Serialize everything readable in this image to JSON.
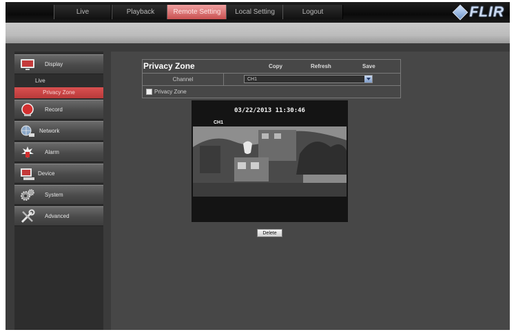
{
  "nav": {
    "tabs": [
      {
        "label": "Live",
        "active": false
      },
      {
        "label": "Playback",
        "active": false
      },
      {
        "label": "Remote Setting",
        "active": true
      },
      {
        "label": "Local Setting",
        "active": false
      },
      {
        "label": "Logout",
        "active": false
      }
    ],
    "logo_text": "FLIR"
  },
  "sidebar": {
    "items": [
      {
        "label": "Display",
        "icon": "monitor-icon"
      },
      {
        "label": "Record",
        "icon": "record-icon"
      },
      {
        "label": "Network",
        "icon": "network-icon"
      },
      {
        "label": "Alarm",
        "icon": "alarm-icon"
      },
      {
        "label": "Device",
        "icon": "device-icon"
      },
      {
        "label": "System",
        "icon": "gears-icon"
      },
      {
        "label": "Advanced",
        "icon": "tools-icon"
      }
    ],
    "display_subitems": [
      {
        "label": "Live",
        "active": false
      },
      {
        "label": "Privacy Zone",
        "active": true
      }
    ]
  },
  "privacy_zone": {
    "title": "Privacy Zone",
    "actions": {
      "copy": "Copy",
      "refresh": "Refresh",
      "save": "Save"
    },
    "channel_label": "Channel",
    "channel_value": "CH1",
    "checkbox_label": "Privacy Zone",
    "checkbox_checked": false
  },
  "preview": {
    "timestamp": "03/22/2013 11:30:46",
    "channel_overlay": "CH1"
  },
  "delete_label": "Delete",
  "colors": {
    "active_tab": "#c95050",
    "sidebar_active": "#c94444",
    "background": "#474747"
  }
}
